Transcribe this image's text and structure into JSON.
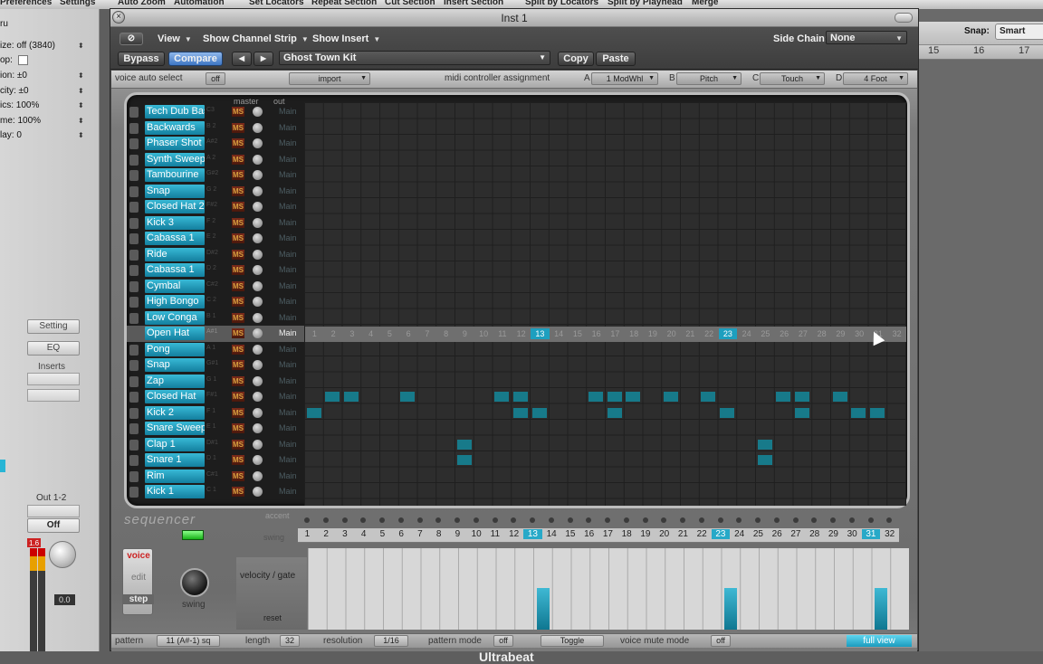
{
  "menubar": {
    "items": [
      "Preferences",
      "Settings",
      "Auto Zoom",
      "Automation",
      "Set Locators",
      "Repeat Section",
      "Cut Section",
      "Insert Section",
      "Split by Locators",
      "Split by Playhead",
      "Merge"
    ]
  },
  "inspector": {
    "title_fragment": "ru",
    "rows": [
      {
        "label": "ize: off (3840)"
      },
      {
        "label": "op:"
      },
      {
        "label": "ion: ±0"
      },
      {
        "label": "city: ±0"
      },
      {
        "label": "ics: 100%"
      },
      {
        "label": "me: 100%"
      },
      {
        "label": "lay: 0"
      }
    ],
    "setting_label": "Setting",
    "eq_label": "EQ",
    "inserts_label": "Inserts",
    "output_label": "Out 1-2",
    "off_label": "Off",
    "meter_value": "1.6",
    "pan_value": "0.0"
  },
  "arrange": {
    "snap_label": "Snap:",
    "snap_value": "Smart",
    "ruler": [
      "15",
      "16",
      "17"
    ]
  },
  "plugin": {
    "title": "Inst 1",
    "view_label": "View",
    "channel_strip_label": "Show Channel Strip",
    "insert_label": "Show Insert",
    "sidechain_label": "Side Chain:",
    "sidechain_value": "None",
    "bypass_label": "Bypass",
    "compare_label": "Compare",
    "prev_label": "◀",
    "next_label": "▶",
    "preset_name": "Ghost Town Kit",
    "copy_label": "Copy",
    "paste_label": "Paste"
  },
  "ub": {
    "voice_auto_select": "voice auto select",
    "voice_auto_select_value": "off",
    "import_label": "import",
    "midi_controller_assignment": "midi controller assignment",
    "a_label": "A",
    "a_value": "1 ModWhl",
    "b_label": "B",
    "b_value": "Pitch",
    "c_label": "C",
    "c_value": "Touch",
    "d_label": "D",
    "d_value": "4 Foot",
    "master_label": "master",
    "out_label": "out",
    "voices": [
      {
        "name": "Tech Dub Bass",
        "note": "C3",
        "out": "Main"
      },
      {
        "name": "Backwards",
        "note": "B 2",
        "out": "Main"
      },
      {
        "name": "Phaser Shot",
        "note": "A#2",
        "out": "Main"
      },
      {
        "name": "Synth Sweep",
        "note": "A 2",
        "out": "Main"
      },
      {
        "name": "Tambourine",
        "note": "G#2",
        "out": "Main"
      },
      {
        "name": "Snap",
        "note": "G 2",
        "out": "Main"
      },
      {
        "name": "Closed Hat 2",
        "note": "F#2",
        "out": "Main"
      },
      {
        "name": "Kick 3",
        "note": "F 2",
        "out": "Main"
      },
      {
        "name": "Cabassa 1",
        "note": "E 2",
        "out": "Main"
      },
      {
        "name": "Ride",
        "note": "D#2",
        "out": "Main"
      },
      {
        "name": "Cabassa 1",
        "note": "D 2",
        "out": "Main"
      },
      {
        "name": "Cymbal",
        "note": "C#2",
        "out": "Main"
      },
      {
        "name": "High Bongo",
        "note": "C 2",
        "out": "Main"
      },
      {
        "name": "Low Conga",
        "note": "B 1",
        "out": "Main"
      },
      {
        "name": "Open Hat",
        "note": "A#1",
        "out": "Main"
      },
      {
        "name": "Pong",
        "note": "A 1",
        "out": "Main"
      },
      {
        "name": "Snap",
        "note": "G#1",
        "out": "Main"
      },
      {
        "name": "Zap",
        "note": "G 1",
        "out": "Main"
      },
      {
        "name": "Closed Hat",
        "note": "F#1",
        "out": "Main"
      },
      {
        "name": "Kick 2",
        "note": "F 1",
        "out": "Main"
      },
      {
        "name": "Snare Sweep",
        "note": "E 1",
        "out": "Main"
      },
      {
        "name": "Clap 1",
        "note": "D#1",
        "out": "Main"
      },
      {
        "name": "Snare 1",
        "note": "D 1",
        "out": "Main"
      },
      {
        "name": "Rim",
        "note": "C#1",
        "out": "Main"
      },
      {
        "name": "Kick 1",
        "note": "C 1",
        "out": "Main"
      }
    ],
    "selected_voice_index": 14,
    "steps": [
      "1",
      "2",
      "3",
      "4",
      "5",
      "6",
      "7",
      "8",
      "9",
      "10",
      "11",
      "12",
      "13",
      "14",
      "15",
      "16",
      "17",
      "18",
      "19",
      "20",
      "21",
      "22",
      "23",
      "24",
      "25",
      "26",
      "27",
      "28",
      "29",
      "30",
      "31",
      "32"
    ],
    "highlight_steps_grid": [
      13,
      23
    ],
    "highlight_steps_seq": [
      13,
      23,
      31
    ],
    "patterns": {
      "18": [
        2,
        3,
        6,
        11,
        12,
        16,
        17,
        18,
        20,
        22,
        26,
        27,
        29
      ],
      "19": [
        1,
        12,
        13,
        17,
        23,
        27,
        30,
        31
      ],
      "21": [
        9,
        25
      ],
      "22": [
        9,
        25
      ]
    },
    "velocity_steps": [
      13,
      23,
      31
    ],
    "sequencer_label": "sequencer",
    "accent_label": "accent",
    "swing_label": "swing",
    "voice_label": "voice",
    "edit_label": "edit",
    "step_label": "step",
    "velocity_gate_label": "velocity / gate",
    "reset_label": "reset",
    "bottom": {
      "pattern_label": "pattern",
      "pattern_value": "11 (A#-1)",
      "pattern_sq": "sq",
      "length_label": "length",
      "length_value": "32",
      "resolution_label": "resolution",
      "resolution_value": "1/16",
      "pattern_mode_label": "pattern mode",
      "pattern_mode_value": "off",
      "toggle_value": "Toggle",
      "voice_mute_mode_label": "voice mute mode",
      "voice_mute_mode_value": "off",
      "full_view_label": "full view"
    },
    "logo": "Ultrabeat"
  }
}
